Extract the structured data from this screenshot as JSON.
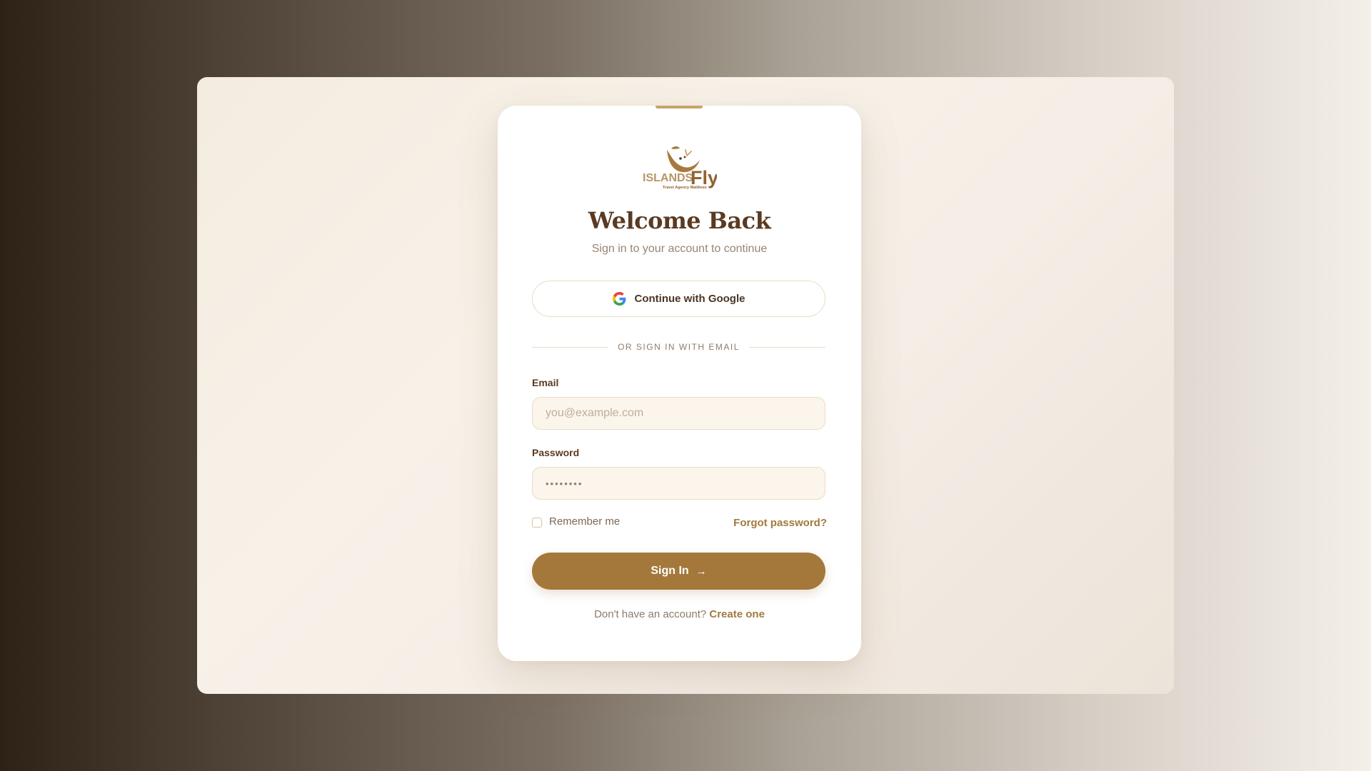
{
  "logo": {
    "brand_first": "ISLANDS",
    "brand_second": "Fly",
    "tagline": "Travel Agency Maldives"
  },
  "heading": {
    "title": "Welcome Back",
    "subtitle": "Sign in to your account to continue"
  },
  "google_button": {
    "label": "Continue with Google",
    "icon": "google-icon"
  },
  "divider": {
    "text": "OR SIGN IN WITH EMAIL"
  },
  "email": {
    "label": "Email",
    "placeholder": "you@example.com",
    "value": ""
  },
  "password": {
    "label": "Password",
    "masked_value": "••••••••"
  },
  "remember_me": {
    "label": "Remember me",
    "checked": false
  },
  "forgot_password": {
    "label": "Forgot password?"
  },
  "sign_in_button": {
    "label": "Sign In",
    "icon": "arrow-right-icon"
  },
  "signup": {
    "prompt": "Don't have an account?",
    "link": "Create one"
  },
  "colors": {
    "accent": "#a4783a",
    "accent_bar": "#c9a465",
    "heading": "#5a3a22",
    "muted_text": "#9a8470",
    "input_bg": "#fbf5ec",
    "input_border": "#ecdcc4"
  }
}
